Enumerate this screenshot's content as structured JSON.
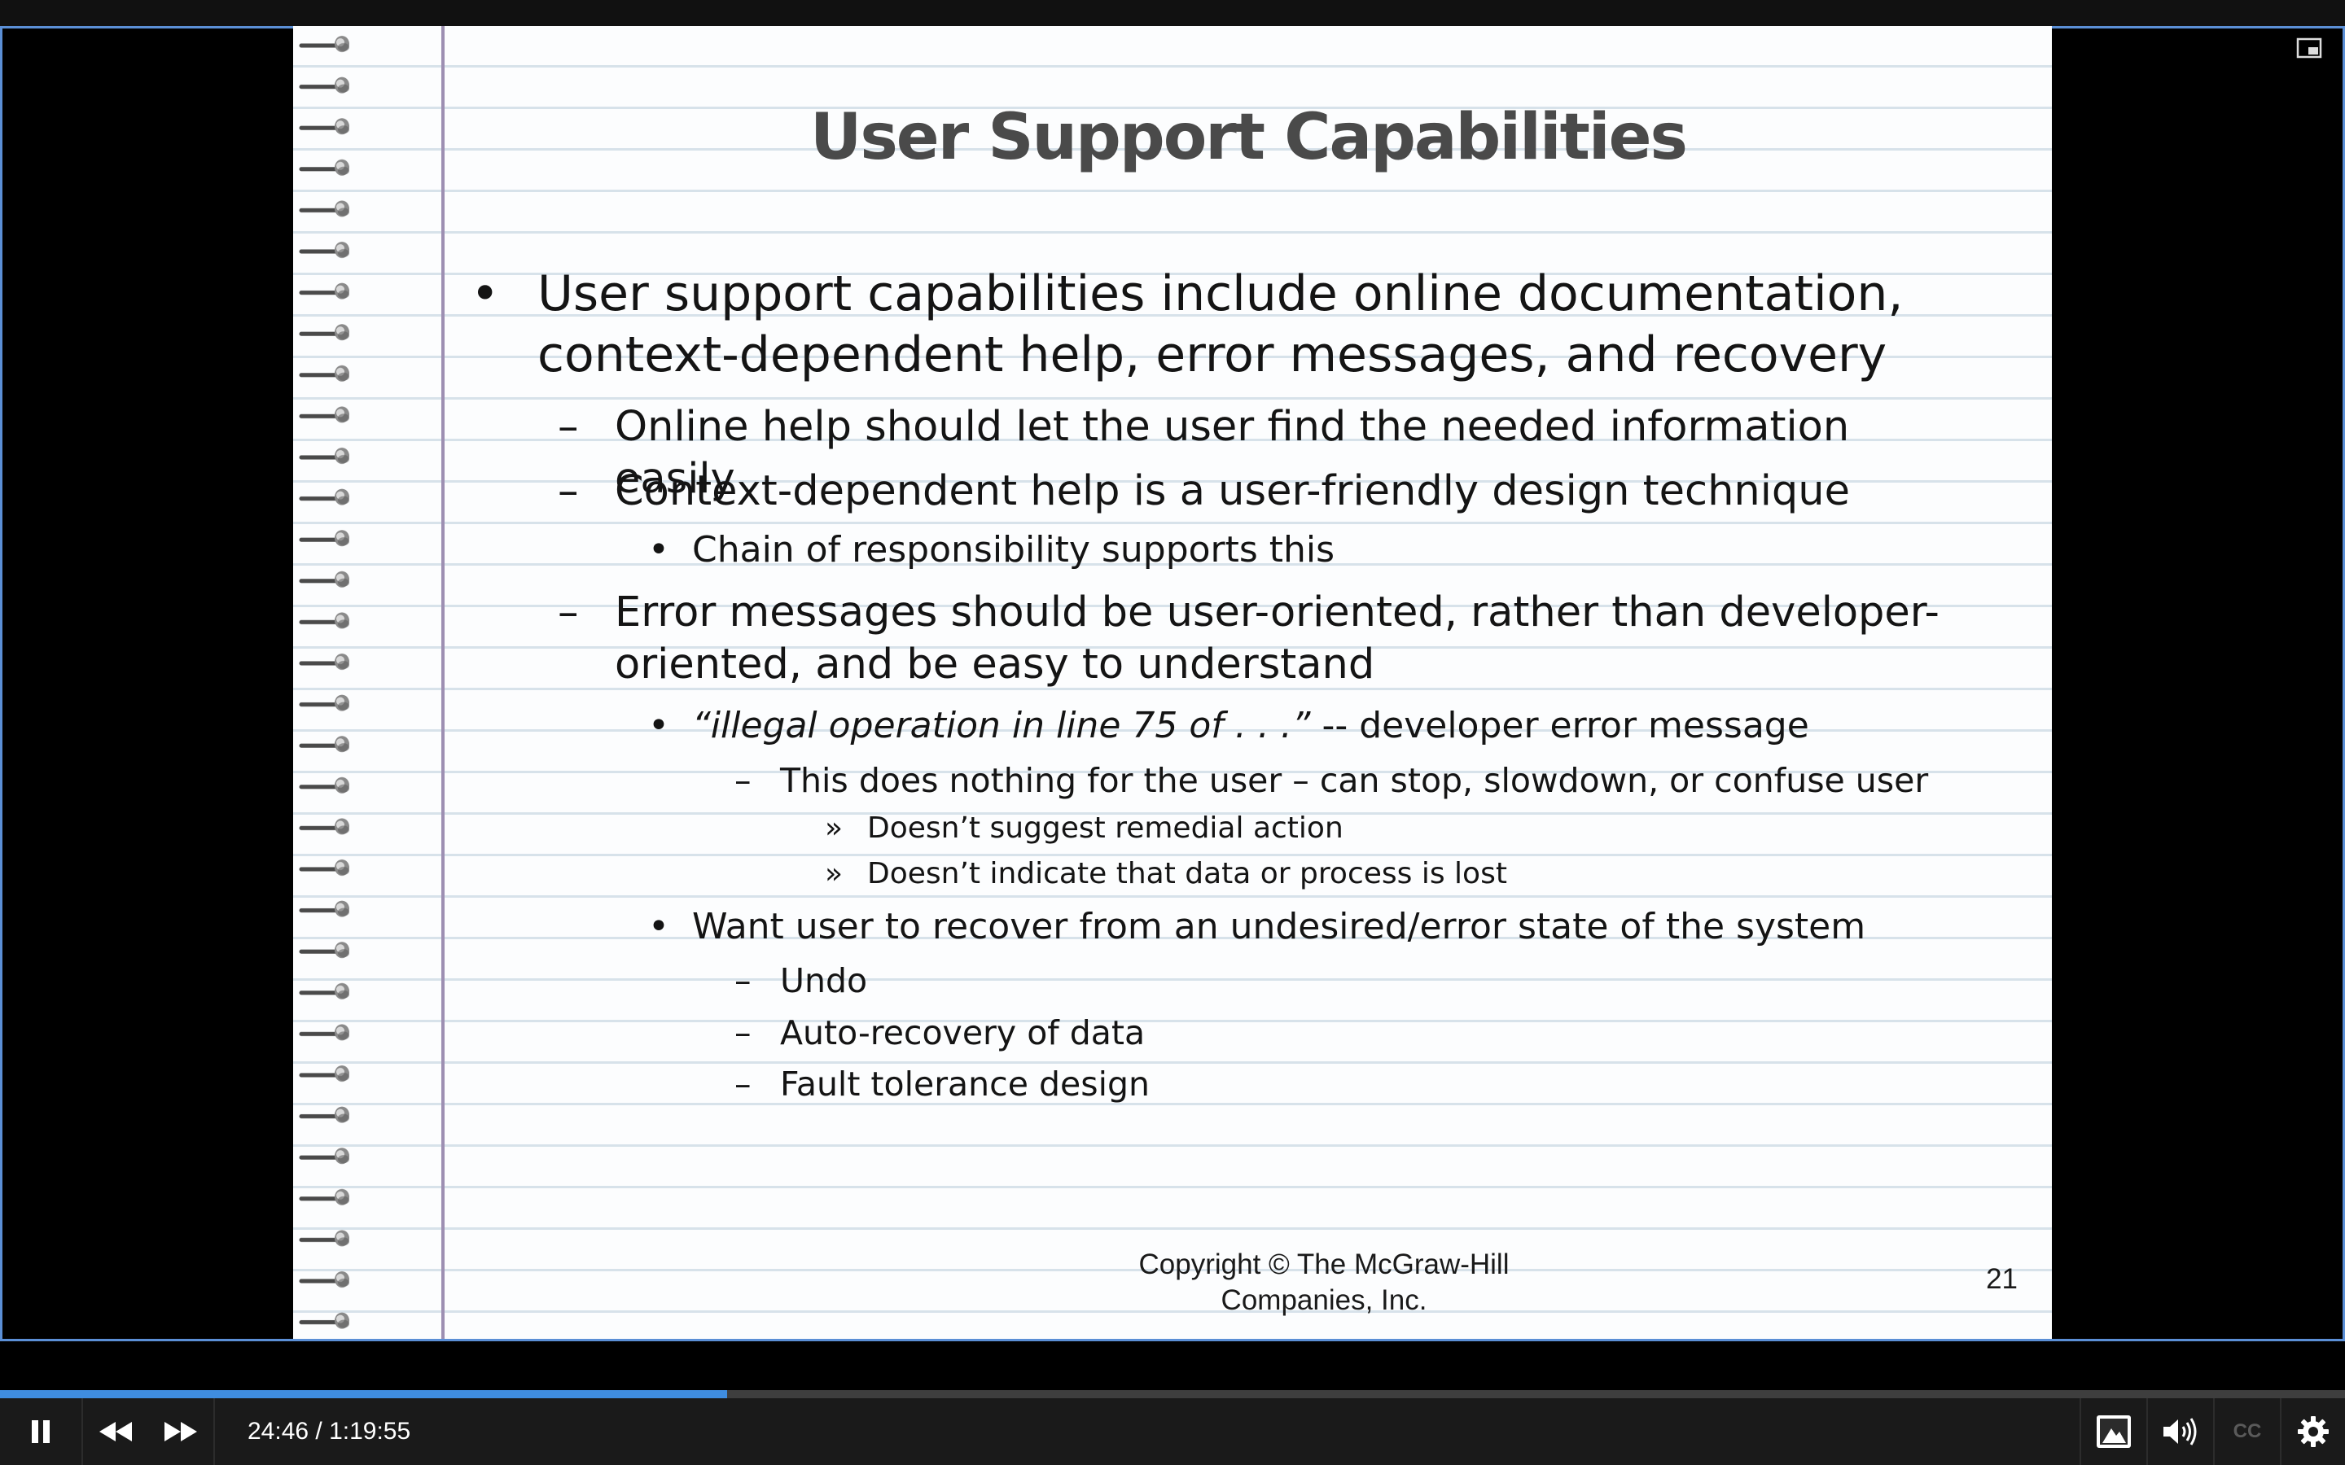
{
  "slide": {
    "title": "User Support Capabilities",
    "bullets": [
      {
        "marker": "•",
        "text": "User support capabilities include online documentation, context-dependent help, error messages, and recovery"
      },
      {
        "marker": "–",
        "text": "Online help should let the user find the needed information easily"
      },
      {
        "marker": "–",
        "text": "Context-dependent help is a user-friendly design technique"
      },
      {
        "marker": "•",
        "text": "Chain of responsibility supports this"
      },
      {
        "marker": "–",
        "text": "Error messages should be user-oriented, rather than developer-oriented, and be easy to understand"
      },
      {
        "marker": "•",
        "quote": "“illegal operation in line 75 of  . . .”",
        "text": " -- developer error message"
      },
      {
        "marker": "–",
        "text": "This does nothing for the user – can stop, slowdown, or confuse user"
      },
      {
        "marker": "»",
        "text": "Doesn’t suggest remedial action"
      },
      {
        "marker": "»",
        "text": "Doesn’t indicate that data or process is lost"
      },
      {
        "marker": "•",
        "text": "Want user to recover from an undesired/error state of the system"
      },
      {
        "marker": "–",
        "text": "Undo"
      },
      {
        "marker": "–",
        "text": "Auto-recovery of data"
      },
      {
        "marker": "–",
        "text": "Fault tolerance design"
      }
    ],
    "footer_line1": "Copyright © The McGraw-Hill",
    "footer_line2": "Companies, Inc.",
    "page_number": "21"
  },
  "player": {
    "time_display": "24:46 / 1:19:55",
    "progress_fraction": 0.31,
    "cc_label": "CC",
    "icons": {
      "play_pause": "pause-icon",
      "rewind": "rewind-icon",
      "forward": "fast-forward-icon",
      "theater": "theater-mode-icon",
      "volume": "volume-icon",
      "captions": "closed-captions-icon",
      "settings": "gear-icon",
      "pip": "picture-in-picture-icon"
    },
    "colors": {
      "progress": "#3f8de0",
      "frame_border": "#5b8fd6"
    }
  }
}
